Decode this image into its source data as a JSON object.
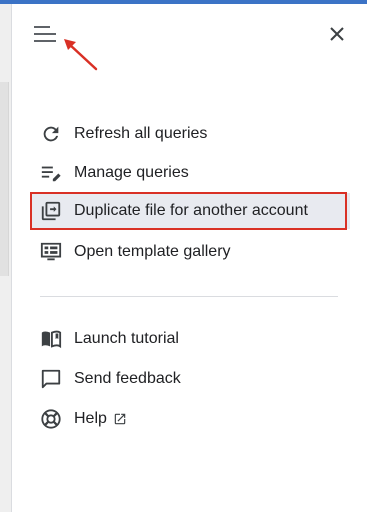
{
  "panel": {
    "menu_icon": "hamburger-menu-icon",
    "close_icon": "close-icon",
    "annotation_color": "#d93025"
  },
  "menu": {
    "group1": [
      {
        "label": "Refresh all queries",
        "icon": "refresh-icon"
      },
      {
        "label": "Manage queries",
        "icon": "manage-queries-icon"
      },
      {
        "label": "Duplicate file for another account",
        "icon": "duplicate-file-icon",
        "highlighted": true
      },
      {
        "label": "Open template gallery",
        "icon": "template-gallery-icon"
      }
    ],
    "group2": [
      {
        "label": "Launch tutorial",
        "icon": "book-icon"
      },
      {
        "label": "Send feedback",
        "icon": "feedback-icon"
      },
      {
        "label": "Help",
        "icon": "help-lifebuoy-icon",
        "external_icon": "open-in-new-icon"
      }
    ]
  }
}
